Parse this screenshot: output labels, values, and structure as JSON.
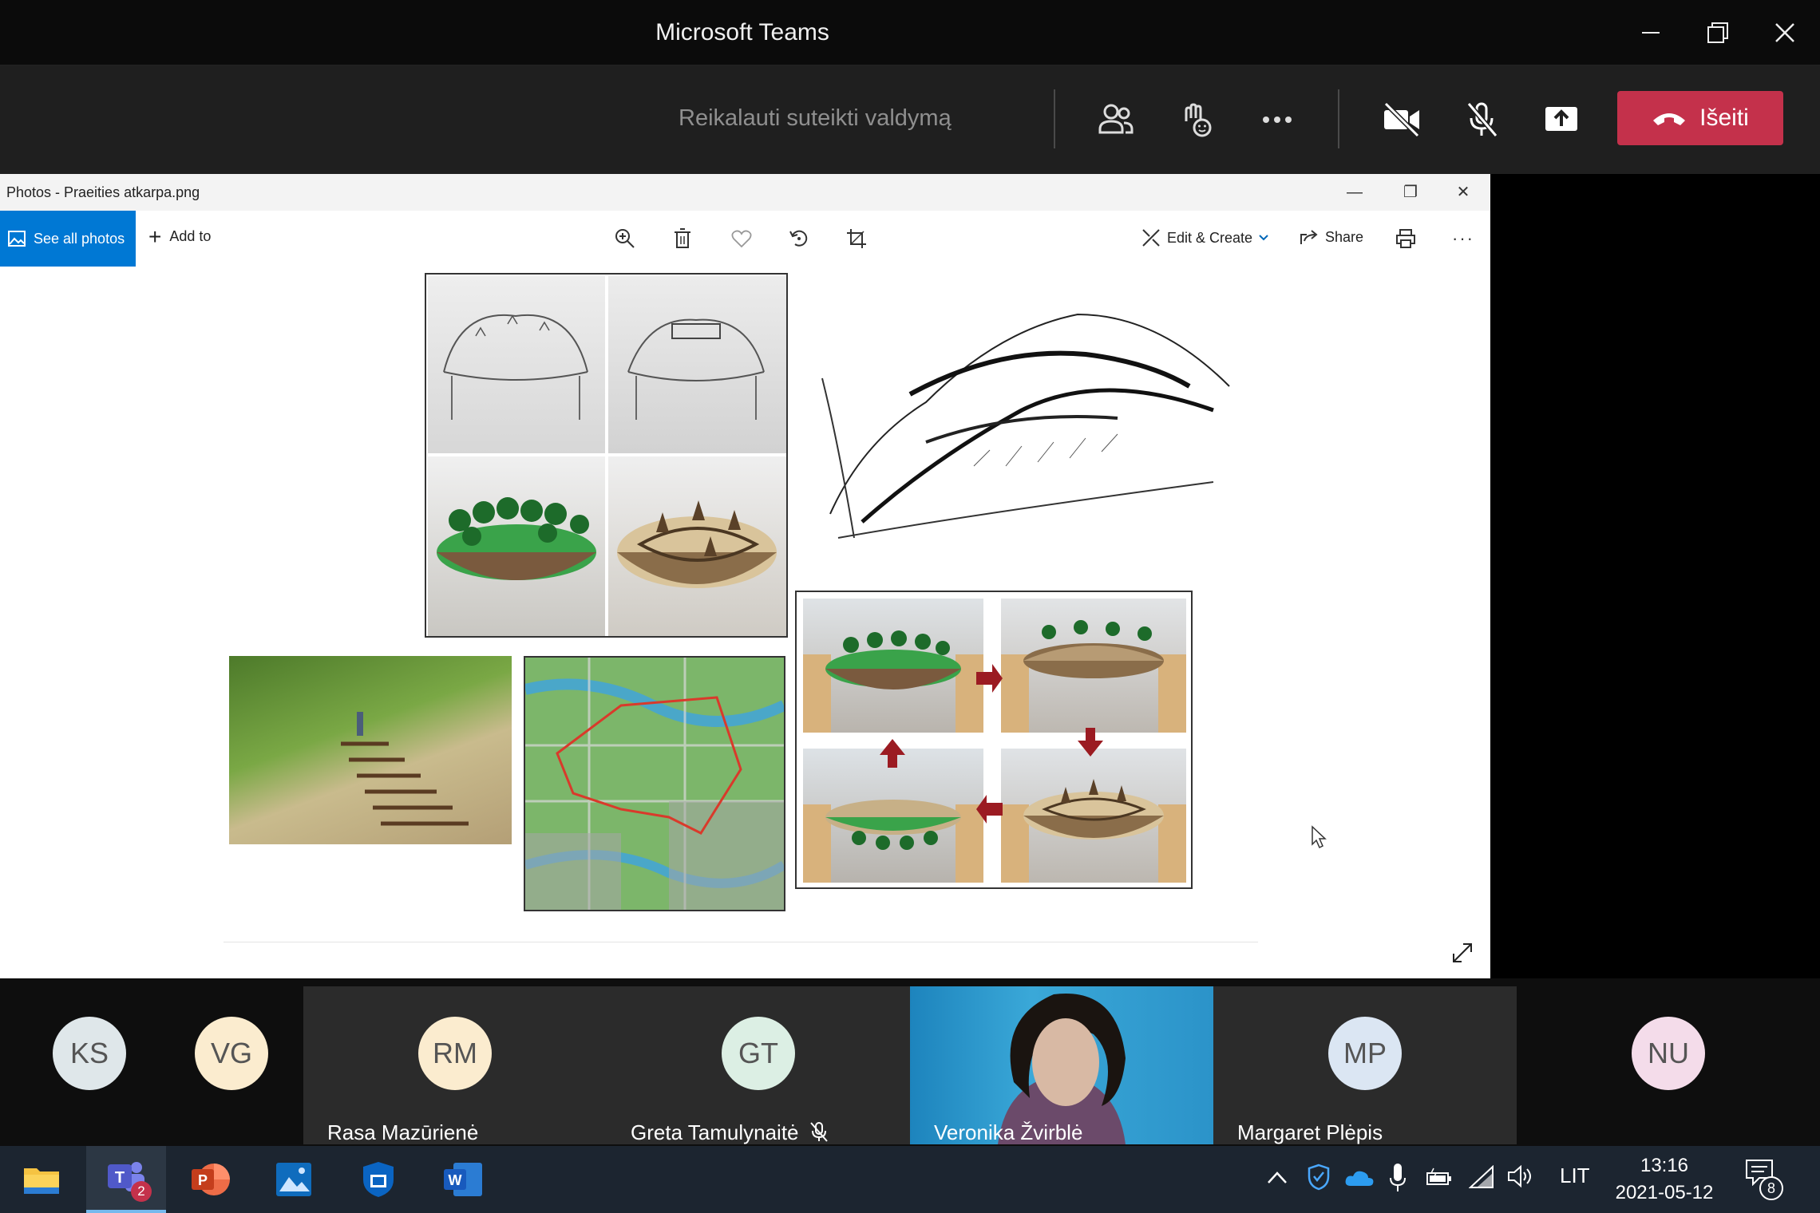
{
  "titlebar": {
    "title": "Microsoft Teams",
    "minimize": "—",
    "restore": "❐",
    "close": "✕"
  },
  "toolbar": {
    "request_control": "Reikalauti suteikti valdymą",
    "leave_label": "Išeiti",
    "colors": {
      "leave": "#c4314b"
    }
  },
  "photos": {
    "window_title": "Photos - Praeities atkarpa.png",
    "see_all_photos": "See all photos",
    "add_to": "Add to",
    "edit_create": "Edit & Create",
    "share": "Share",
    "more": "···"
  },
  "participants": [
    {
      "initials": "KS",
      "name": "",
      "color": "#dfe7ea"
    },
    {
      "initials": "VG",
      "name": "",
      "color": "#fbeccf"
    },
    {
      "initials": "RM",
      "name": "Rasa Mazūrienė",
      "color": "#fbeccf"
    },
    {
      "initials": "GT",
      "name": "Greta Tamulynaitė",
      "color": "#dcefe4"
    },
    {
      "initials": "",
      "name": "Veronika Žvirblė",
      "color": "#2b93c9"
    },
    {
      "initials": "MP",
      "name": "Margaret Plėpis",
      "color": "#dbe6f3"
    },
    {
      "initials": "NU",
      "name": "",
      "color": "#f4dcea"
    }
  ],
  "taskbar": {
    "teams_badge": "2",
    "language": "LIT",
    "time": "13:16",
    "date": "2021-05-12",
    "notifications": "8"
  }
}
